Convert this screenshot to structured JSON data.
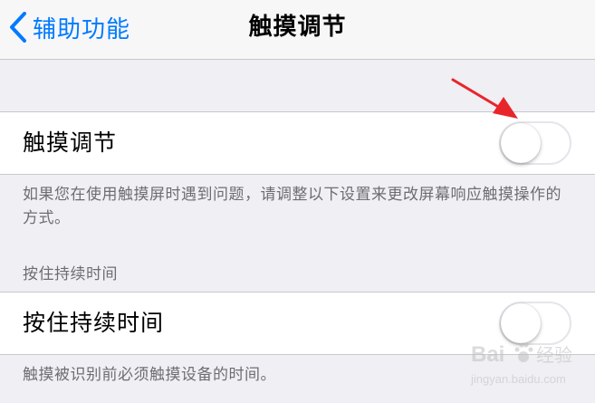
{
  "navbar": {
    "back_label": "辅助功能",
    "title": "触摸调节"
  },
  "touch_accommodations": {
    "label": "触摸调节",
    "enabled": false,
    "footer": "如果您在使用触摸屏时遇到问题，请调整以下设置来更改屏幕响应触摸操作的方式。"
  },
  "hold_duration": {
    "section_header": "按住持续时间",
    "label": "按住持续时间",
    "enabled": false,
    "footer": "触摸被识别前必须触摸设备的时间。"
  },
  "watermark": {
    "text": "Bai",
    "text2": "经验",
    "url": "jingyan.baidu.com"
  },
  "colors": {
    "accent": "#007aff",
    "annotation_arrow": "#e8262a",
    "switch_off_border": "#e5e5ea",
    "background": "#efeff4"
  }
}
